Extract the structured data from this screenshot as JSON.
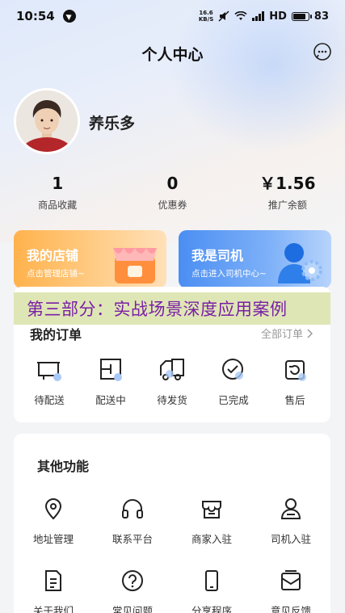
{
  "status_bar": {
    "time": "10:54",
    "net_speed_top": "16.6",
    "net_speed_bottom": "KB/S",
    "network": "HD",
    "battery": "83",
    "battery_level": 0.83
  },
  "header": {
    "title": "个人中心",
    "message_icon": "chat-bubble-icon"
  },
  "profile": {
    "name": "养乐多"
  },
  "stats": [
    {
      "value": "1",
      "label": "商品收藏"
    },
    {
      "value": "0",
      "label": "优惠券"
    },
    {
      "value": "￥1.56",
      "label": "推广余额"
    }
  ],
  "role_cards": {
    "shop": {
      "title": "我的店铺",
      "subtitle": "点击管理店铺~",
      "color": "#ffb24c"
    },
    "driver": {
      "title": "我是司机",
      "subtitle": "点击进入司机中心~",
      "color": "#4b8ef2"
    }
  },
  "banner": {
    "text": "第三部分：实战场景深度应用案例",
    "color": "#7a1fa5"
  },
  "orders": {
    "title": "我的订单",
    "all_label": "全部订单",
    "items": [
      {
        "label": "待配送",
        "icon": "pending-delivery-icon"
      },
      {
        "label": "配送中",
        "icon": "in-delivery-icon"
      },
      {
        "label": "待发货",
        "icon": "to-ship-truck-icon"
      },
      {
        "label": "已完成",
        "icon": "completed-check-icon"
      },
      {
        "label": "售后",
        "icon": "after-sales-icon"
      }
    ]
  },
  "functions": {
    "title": "其他功能",
    "items": [
      {
        "label": "地址管理",
        "icon": "location-pin-icon"
      },
      {
        "label": "联系平台",
        "icon": "headset-icon"
      },
      {
        "label": "商家入驻",
        "icon": "store-icon"
      },
      {
        "label": "司机入驻",
        "icon": "driver-person-icon"
      },
      {
        "label": "关于我们",
        "icon": "document-icon"
      },
      {
        "label": "常见问题",
        "icon": "question-icon"
      },
      {
        "label": "分享程序",
        "icon": "phone-share-icon"
      },
      {
        "label": "意见反馈",
        "icon": "feedback-mail-icon"
      }
    ]
  }
}
